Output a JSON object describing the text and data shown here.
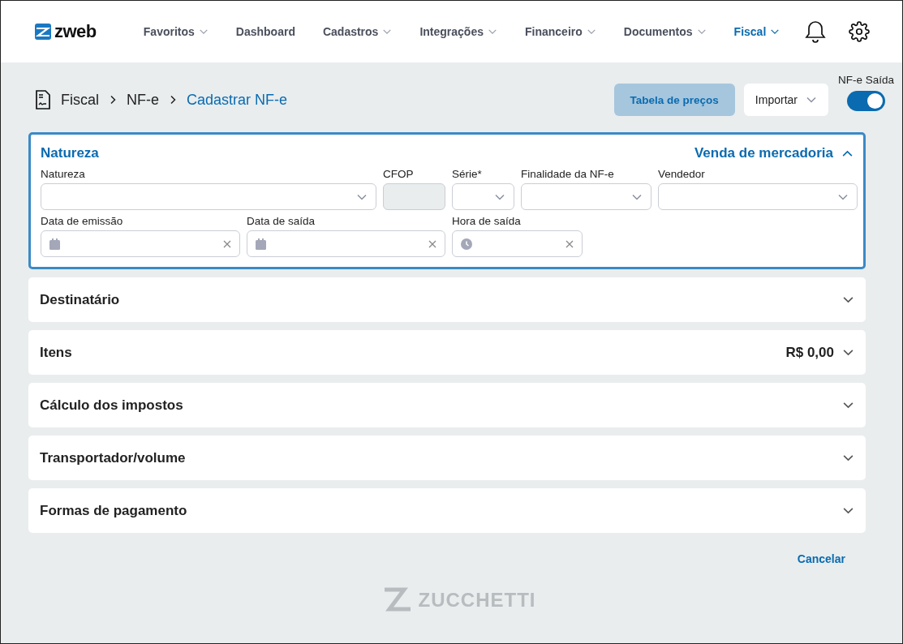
{
  "header": {
    "logo": "zweb",
    "nav": [
      {
        "label": "Favoritos",
        "dropdown": true,
        "selected": false
      },
      {
        "label": "Dashboard",
        "dropdown": false,
        "selected": false
      },
      {
        "label": "Cadastros",
        "dropdown": true,
        "selected": false
      },
      {
        "label": "Integrações",
        "dropdown": true,
        "selected": false
      },
      {
        "label": "Financeiro",
        "dropdown": true,
        "selected": false
      },
      {
        "label": "Documentos",
        "dropdown": true,
        "selected": false
      },
      {
        "label": "Fiscal",
        "dropdown": true,
        "selected": true
      }
    ]
  },
  "breadcrumb": [
    "Fiscal",
    "NF-e",
    "Cadastrar NF-e"
  ],
  "actions": {
    "price_table": "Tabela de preços",
    "import": "Importar",
    "toggle": {
      "label": "NF-e Saída",
      "on": true
    }
  },
  "sections": [
    {
      "title": "Natureza",
      "value": "Venda de mercadoria",
      "expanded": true,
      "rows": [
        [
          {
            "label": "Natureza",
            "kind": "select"
          },
          {
            "label": "CFOP",
            "kind": "readonly"
          },
          {
            "label": "Série*",
            "kind": "select"
          },
          {
            "label": "Finalidade da NF-e",
            "kind": "select"
          },
          {
            "label": "Vendedor",
            "kind": "select"
          }
        ],
        [
          {
            "label": "Data de emissão",
            "kind": "date"
          },
          {
            "label": "Data de saída",
            "kind": "date"
          },
          {
            "label": "Hora de saída",
            "kind": "time"
          }
        ]
      ]
    },
    {
      "title": "Destinatário",
      "expanded": false
    },
    {
      "title": "Itens",
      "value": "R$ 0,00",
      "expanded": false
    },
    {
      "title": "Cálculo dos impostos",
      "expanded": false
    },
    {
      "title": "Transportador/volume",
      "expanded": false
    },
    {
      "title": "Formas de pagamento",
      "expanded": false
    }
  ],
  "cancel": "Cancelar",
  "footer_logo": "ZUCCHETTI"
}
